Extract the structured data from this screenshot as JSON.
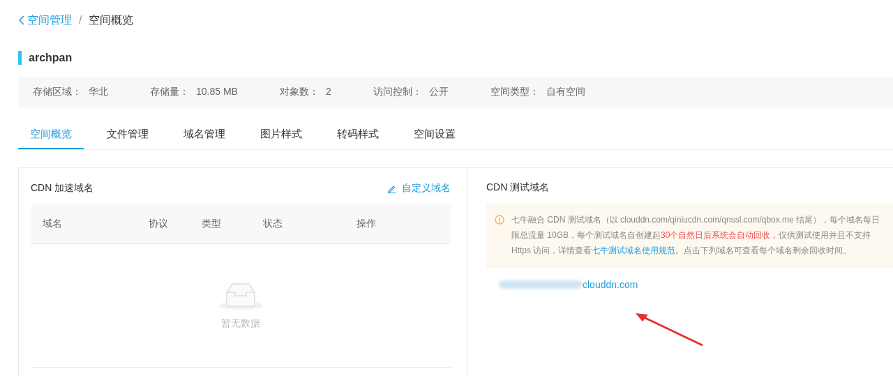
{
  "breadcrumb": {
    "back": "空间管理",
    "separator": "/",
    "current": "空间概览"
  },
  "bucket": {
    "name": "archpan"
  },
  "info": [
    {
      "label": "存储区域：",
      "value": "华北"
    },
    {
      "label": "存储量：",
      "value": "10.85 MB"
    },
    {
      "label": "对象数：",
      "value": "2"
    },
    {
      "label": "访问控制：",
      "value": "公开"
    },
    {
      "label": "空间类型：",
      "value": "自有空间"
    }
  ],
  "tabs": [
    {
      "label": "空间概览",
      "selected": true
    },
    {
      "label": "文件管理",
      "selected": false
    },
    {
      "label": "域名管理",
      "selected": false
    },
    {
      "label": "图片样式",
      "selected": false
    },
    {
      "label": "转码样式",
      "selected": false
    },
    {
      "label": "空间设置",
      "selected": false
    }
  ],
  "cdn_domains": {
    "title": "CDN 加速域名",
    "action": "自定义域名",
    "columns": [
      "域名",
      "协议",
      "类型",
      "状态",
      "操作"
    ],
    "empty_text": "暂无数据"
  },
  "test_domains": {
    "title": "CDN 测试域名",
    "notice": [
      {
        "kind": "plain",
        "text": "七牛融合 CDN 测试域名（以 clouddn.com/qiniucdn.com/qnssl.com/qbox.me 结尾），每个域名每日限总流量 10GB，每个测试域名自创建起"
      },
      {
        "kind": "warn",
        "text": "30个自然日后系统会自动回收，"
      },
      {
        "kind": "plain",
        "text": "仅供测试使用并且不支持 Https 访问，详情查看"
      },
      {
        "kind": "link",
        "text": "七牛测试域名使用规范"
      },
      {
        "kind": "plain",
        "text": "。点击下列域名可查看每个域名剩余回收时间。"
      }
    ],
    "domain": "clouddn.com"
  }
}
